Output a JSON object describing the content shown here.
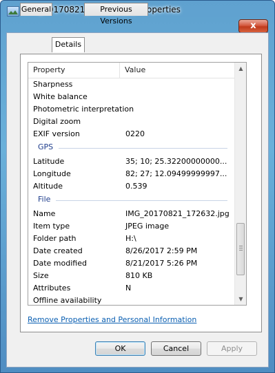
{
  "window": {
    "title": "IMG_20170821_172632.jpg Properties",
    "close_label": "x"
  },
  "tabs": [
    {
      "label": "General",
      "active": false
    },
    {
      "label": "Details",
      "active": true
    },
    {
      "label": "Previous Versions",
      "active": false
    }
  ],
  "list": {
    "col_property": "Property",
    "col_value": "Value",
    "rows": [
      {
        "type": "row",
        "property": "Sharpness",
        "value": ""
      },
      {
        "type": "row",
        "property": "White balance",
        "value": ""
      },
      {
        "type": "row",
        "property": "Photometric interpretation",
        "value": ""
      },
      {
        "type": "row",
        "property": "Digital zoom",
        "value": ""
      },
      {
        "type": "row",
        "property": "EXIF version",
        "value": "0220"
      },
      {
        "type": "group",
        "label": "GPS"
      },
      {
        "type": "row",
        "property": "Latitude",
        "value": "35; 10; 25.32200000000..."
      },
      {
        "type": "row",
        "property": "Longitude",
        "value": "82; 27; 12.09499999997..."
      },
      {
        "type": "row",
        "property": "Altitude",
        "value": "0.539"
      },
      {
        "type": "group",
        "label": "File"
      },
      {
        "type": "row",
        "property": "Name",
        "value": "IMG_20170821_172632.jpg"
      },
      {
        "type": "row",
        "property": "Item type",
        "value": "JPEG image"
      },
      {
        "type": "row",
        "property": "Folder path",
        "value": "H:\\"
      },
      {
        "type": "row",
        "property": "Date created",
        "value": "8/26/2017 2:59 PM"
      },
      {
        "type": "row",
        "property": "Date modified",
        "value": "8/21/2017 5:26 PM"
      },
      {
        "type": "row",
        "property": "Size",
        "value": "810 KB"
      },
      {
        "type": "row",
        "property": "Attributes",
        "value": "N"
      },
      {
        "type": "row",
        "property": "Offline availability",
        "value": ""
      }
    ]
  },
  "scrollbar": {
    "up_icon": "scroll-up-arrow-icon",
    "down_icon": "scroll-down-arrow-icon"
  },
  "link_text": "Remove Properties and Personal Information",
  "buttons": {
    "ok": "OK",
    "cancel": "Cancel",
    "apply": "Apply"
  }
}
